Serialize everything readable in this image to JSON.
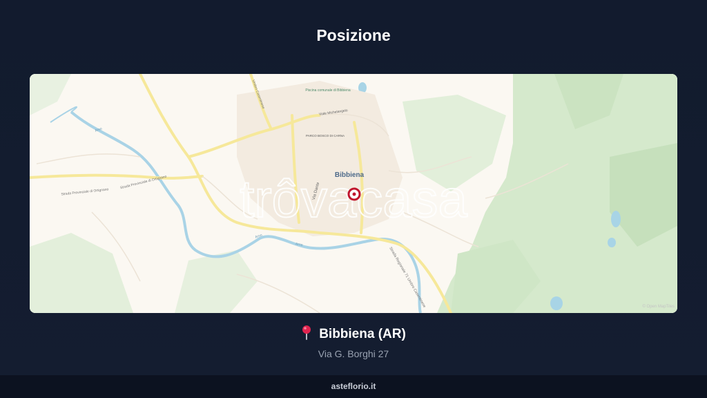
{
  "page": {
    "title": "Posizione"
  },
  "map": {
    "watermark": "trôvacasa",
    "place_labels": {
      "town": "Bibbiena",
      "park_a": "Piscina comunale di Bibbiena",
      "park_b": "PARCO BOSCO DI CARNA",
      "street_michelangelo": "Viale Michelangelo",
      "street_dante": "Via Dante",
      "road_sp_1": "Strada Provinciale di Ortignano",
      "road_sp_2": "Strada Provinciale di Ortignano",
      "road_sr71": "Strada Regionale 71 Umbro Casentinese",
      "road_casentinese": "Umbro Casentinese",
      "river_1": "Arno",
      "river_2": "Arno",
      "river_3": "Arno"
    },
    "attribution": "© Open MapTiles",
    "marker_icon": "map-pin-marker"
  },
  "location": {
    "icon": "round-pushpin-icon",
    "name": "Bibbiena (AR)",
    "address": "Via G. Borghi 27"
  },
  "footer": {
    "site": "asteflorio.it"
  },
  "colors": {
    "background": "#121b2e",
    "map_land": "#fbf8f2",
    "map_green": "#d6ead0",
    "map_water": "#a8d4e6",
    "map_road": "#f7eba0",
    "marker": "#c0152d"
  }
}
